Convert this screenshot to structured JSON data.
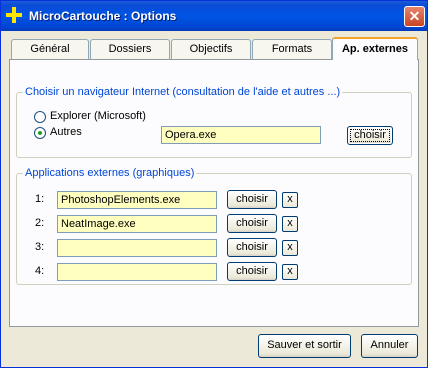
{
  "window": {
    "title": "MicroCartouche : Options",
    "close_glyph": "✕"
  },
  "tabs": [
    "Général",
    "Dossiers",
    "Objectifs",
    "Formats",
    "Ap. externes"
  ],
  "browser_group": {
    "legend": "Choisir un navigateur Internet   (consultation de l'aide et autres ...)",
    "options": [
      {
        "label": "Explorer (Microsoft)",
        "checked": false
      },
      {
        "label": "Autres",
        "checked": true
      }
    ],
    "path_value": "Opera.exe",
    "choose_label": "choisir"
  },
  "apps_group": {
    "legend": "Applications externes (graphiques)",
    "rows": [
      {
        "num": "1:",
        "value": "PhotoshopElements.exe",
        "choose": "choisir",
        "clear": "x"
      },
      {
        "num": "2:",
        "value": "NeatImage.exe",
        "choose": "choisir",
        "clear": "x"
      },
      {
        "num": "3:",
        "value": "",
        "choose": "choisir",
        "clear": "x"
      },
      {
        "num": "4:",
        "value": "",
        "choose": "choisir",
        "clear": "x"
      }
    ]
  },
  "footer": {
    "save_label": "Sauver et sortir",
    "cancel_label": "Annuler"
  }
}
